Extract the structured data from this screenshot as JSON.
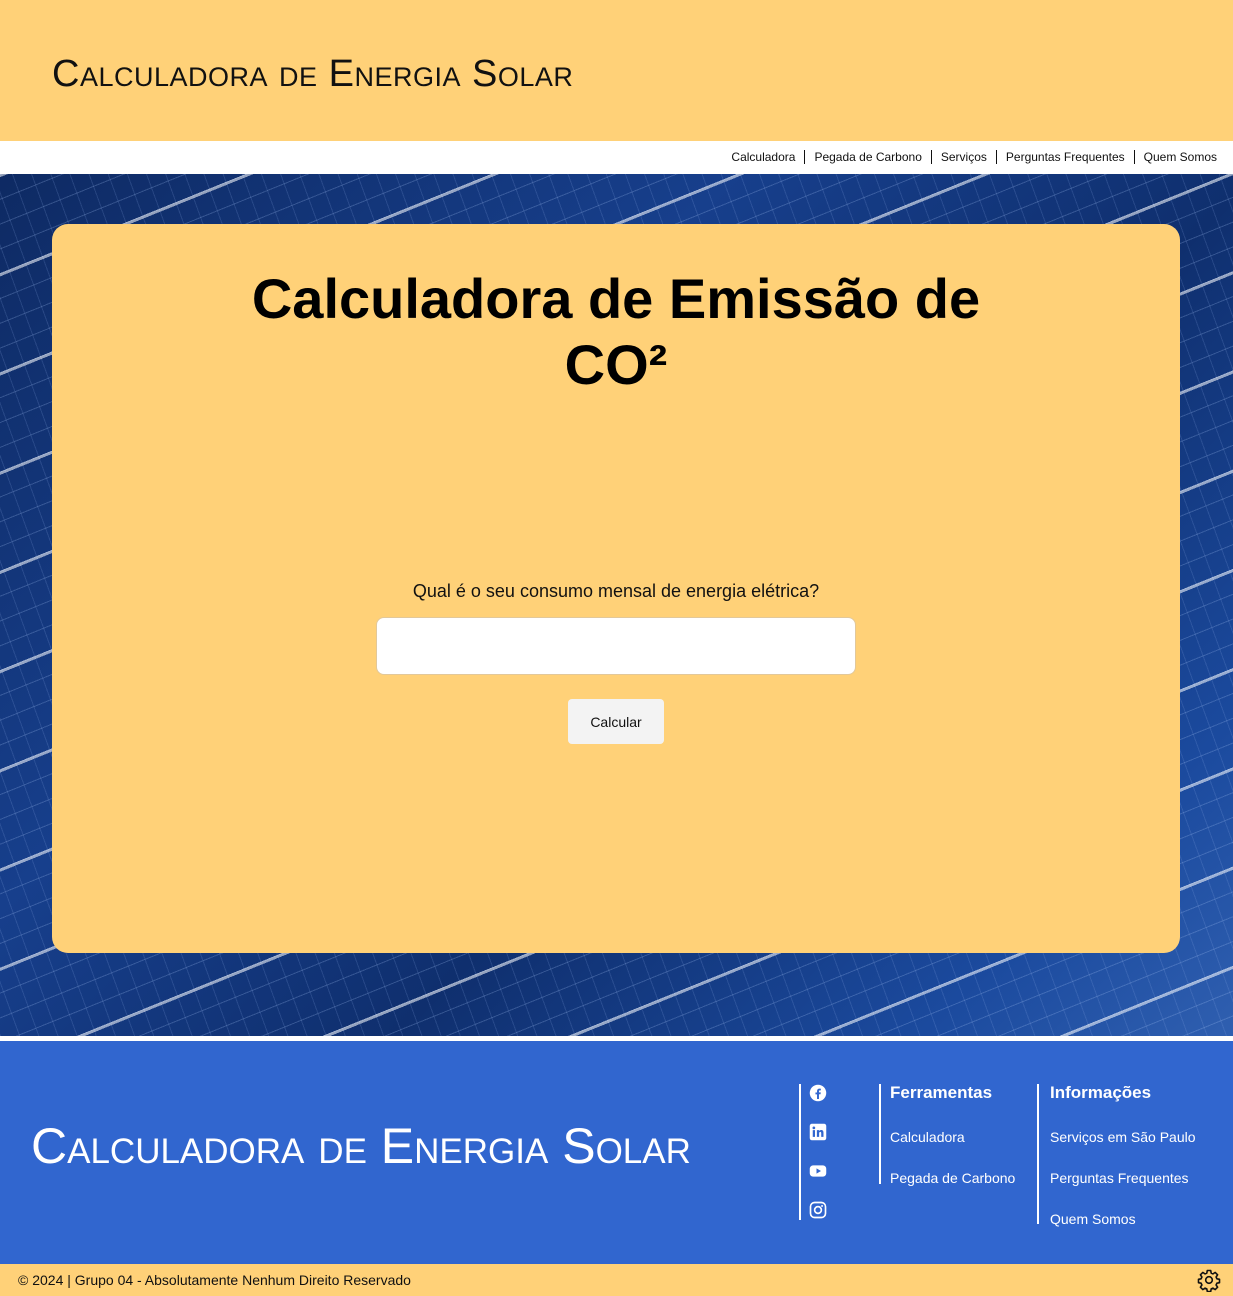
{
  "header": {
    "site_title": "Calculadora de Energia Solar"
  },
  "nav": {
    "items": [
      {
        "label": "Calculadora"
      },
      {
        "label": "Pegada de Carbono"
      },
      {
        "label": "Serviços"
      },
      {
        "label": "Perguntas Frequentes"
      },
      {
        "label": "Quem Somos"
      }
    ]
  },
  "card": {
    "title_line1": "Calculadora de Emissão de",
    "title_line2": "CO²",
    "question": "Qual é o seu consumo mensal de energia elétrica?",
    "input_value": "",
    "button_label": "Calcular"
  },
  "footer": {
    "title": "Calculadora de Energia Solar",
    "social_icons": [
      "facebook-icon",
      "linkedin-icon",
      "youtube-icon",
      "instagram-icon"
    ],
    "tools": {
      "heading": "Ferramentas",
      "links": [
        "Calculadora",
        "Pegada de Carbono"
      ]
    },
    "info": {
      "heading": "Informações",
      "links": [
        "Serviços em São Paulo",
        "Perguntas Frequentes",
        "Quem Somos"
      ]
    }
  },
  "bottom": {
    "copyright": "© 2024 | Grupo 04 - Absolutamente Nenhum Direito Reservado"
  },
  "colors": {
    "header_bg": "#ffd178",
    "footer_bg": "#3166cf",
    "card_bg": "#ffd178"
  }
}
